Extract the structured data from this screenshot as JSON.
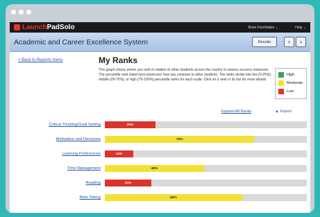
{
  "app": {
    "logo_text_a": "Launch",
    "logo_text_b": "Pad",
    "logo_text_c": "Solo",
    "user_menu": "Brian Fischhaber ⌄",
    "help_menu": "Help ⌄"
  },
  "header": {
    "title": "Academic and Career Excellence System",
    "results_label": "Results",
    "prev_label": "‹",
    "next_label": "›"
  },
  "page": {
    "back_link": "< Back to Reports menu",
    "title": "My Ranks",
    "description": "This graph shows where you rank in relation to other students across the country in various success measures. The percentile rank listed here expresses how you compare to other students. The ranks divide into low (0-25%), middle (26-75%), or high (76-100%) percentile ranks for each scale. Click on a rank or its bar for more details.",
    "expand_all": "Expand All Ranks",
    "export": "Export"
  },
  "legend": [
    {
      "label": "High",
      "color": "#3aa655"
    },
    {
      "label": "Moderate",
      "color": "#f2e033"
    },
    {
      "label": "Low",
      "color": "#d9352b"
    }
  ],
  "ranks": [
    {
      "label": "Critical Thinking/Goal Setting",
      "value": 25,
      "text": "25%",
      "level": "low"
    },
    {
      "label": "Motivation and Decisions",
      "value": 74,
      "text": "74%",
      "level": "moderate"
    },
    {
      "label": "Learning Preferences",
      "value": 14,
      "text": "14%",
      "level": "low"
    },
    {
      "label": "Time Management",
      "value": 49,
      "text": "49%",
      "level": "moderate"
    },
    {
      "label": "Reading",
      "value": 23,
      "text": "23%",
      "level": "low"
    },
    {
      "label": "Note Taking",
      "value": 68,
      "text": "68%",
      "level": "moderate"
    }
  ],
  "colors": {
    "low": "#d9352b",
    "moderate": "#f2e033",
    "high": "#3aa655",
    "background": "#30b8b8"
  }
}
